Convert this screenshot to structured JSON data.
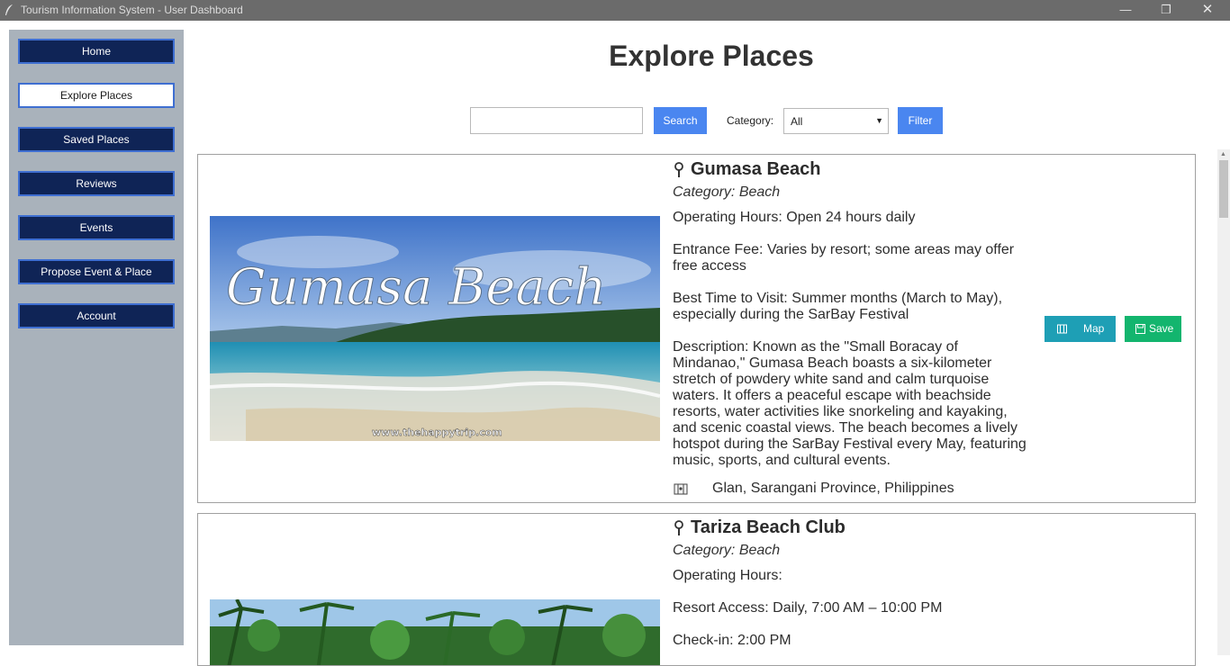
{
  "window": {
    "title": "Tourism Information System - User Dashboard",
    "controls": {
      "minimize": "—",
      "maximize": "❐",
      "close": "✕"
    }
  },
  "sidebar": {
    "items": [
      {
        "label": "Home"
      },
      {
        "label": "Explore Places",
        "active": true
      },
      {
        "label": "Saved Places"
      },
      {
        "label": "Reviews"
      },
      {
        "label": "Events"
      },
      {
        "label": "Propose Event & Place"
      },
      {
        "label": "Account"
      }
    ]
  },
  "main": {
    "title": "Explore Places",
    "search": {
      "value": "",
      "button_label": "Search"
    },
    "filter": {
      "category_label": "Category:",
      "selected": "All",
      "button_label": "Filter"
    }
  },
  "places": [
    {
      "name": "Gumasa Beach",
      "category": "Category: Beach",
      "image_caption": "Gumasa Beach",
      "image_watermark": "www.thehappytrip.com",
      "details": [
        "Operating Hours: Open 24 hours daily",
        "Entrance Fee: Varies by resort; some areas may offer free access",
        "Best Time to Visit: Summer months (March to May), especially during the SarBay Festival",
        "Description: Known as the \"Small Boracay of Mindanao,\" Gumasa Beach boasts a six-kilometer stretch of powdery white sand and calm turquoise waters. It offers a peaceful escape with beachside resorts, water activities like snorkeling and kayaking, and scenic coastal views. The beach becomes a lively hotspot during the SarBay Festival every May, featuring music, sports, and cultural events."
      ],
      "location": "Glan, Sarangani Province, Philippines",
      "map_label": "Map",
      "save_label": "Save"
    },
    {
      "name": "Tariza Beach Club",
      "category": "Category: Beach",
      "details": [
        "Operating Hours:",
        "Resort Access: Daily, 7:00 AM – 10:00 PM",
        "Check-in: 2:00 PM"
      ]
    }
  ],
  "colors": {
    "sidebar_bg": "#a9b2bb",
    "nav_button": "#0f2456",
    "nav_border": "#3f6fd1",
    "primary_button": "#4a86f0",
    "map_button": "#1e9fb5",
    "save_button": "#13b56e"
  }
}
